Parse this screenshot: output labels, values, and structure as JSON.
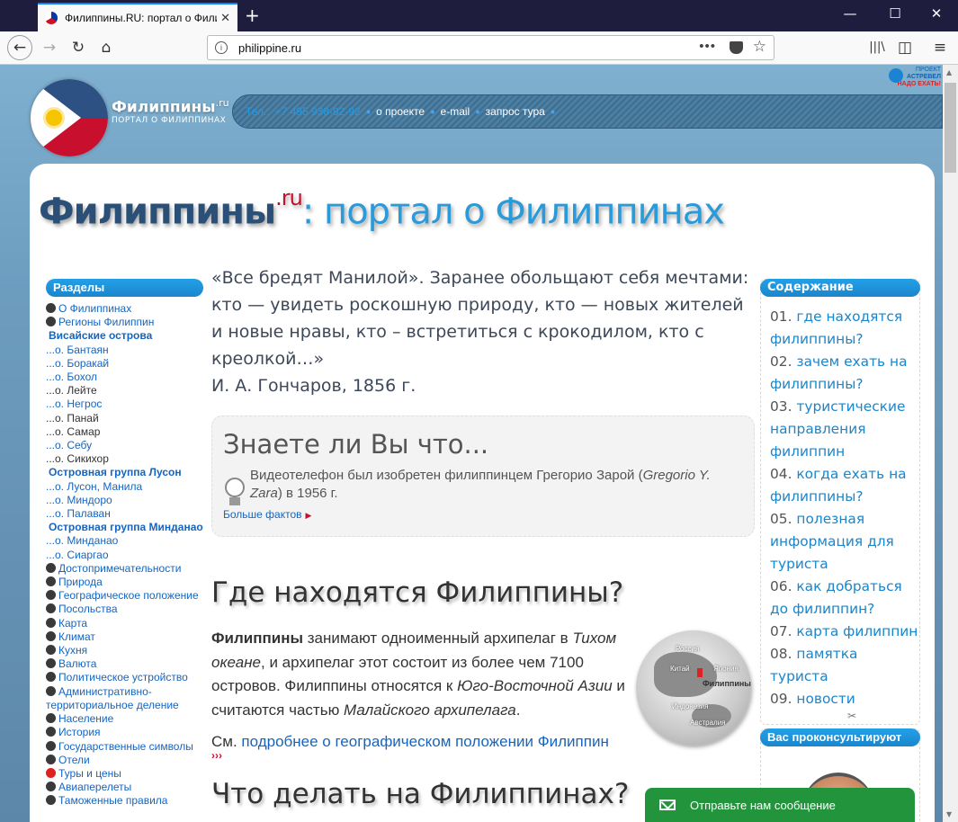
{
  "tab": {
    "title": "Филиппины.RU: портал о Филиппинах",
    "close": "✕",
    "new": "+"
  },
  "window": {
    "minimize": "—",
    "maximize": "☐",
    "close": "✕"
  },
  "nav": {
    "back": "←",
    "forward": "→",
    "reload": "↻",
    "home": "⌂",
    "url": "philippine.ru",
    "more": "•••",
    "star": "☆",
    "library": "|||\\",
    "sidebar": "◫",
    "menu": "≡"
  },
  "header": {
    "brand_name": "Филиппины",
    "brand_sup": ".ru",
    "brand_sub": "ПОРТАЛ О ФИЛИППИНАХ",
    "tel_label": "Тел.:",
    "tel": "+7 495 938-92-92",
    "links": [
      "о проекте",
      "e-mail",
      "запрос тура"
    ],
    "astravel_1": "ПРОЕКТ",
    "astravel_2": "АСТРЕВЕЛ",
    "astravel_3": "НАДО ЕХАТЬ!"
  },
  "title": {
    "main": "Филиппины",
    "sup": ".ru",
    "rest": ": портал о Филиппинах"
  },
  "sections": {
    "header": "Разделы",
    "items": [
      {
        "label": "О Филиппинах",
        "type": "icon"
      },
      {
        "label": "Регионы Филиппин",
        "type": "icon"
      },
      {
        "label": "Висайские острова",
        "type": "group"
      },
      {
        "label": "...о. Бантаян",
        "type": "link"
      },
      {
        "label": "...о. Боракай",
        "type": "link"
      },
      {
        "label": "...о. Бохол",
        "type": "link"
      },
      {
        "label": "...о. Лейте",
        "type": "grey"
      },
      {
        "label": "...о. Негрос",
        "type": "link"
      },
      {
        "label": "...о. Панай",
        "type": "grey"
      },
      {
        "label": "...о. Самар",
        "type": "grey"
      },
      {
        "label": "...о. Себу",
        "type": "link"
      },
      {
        "label": "...о. Сикихор",
        "type": "grey"
      },
      {
        "label": "Островная группа Лусон",
        "type": "group"
      },
      {
        "label": "...о. Лусон, Манила",
        "type": "link"
      },
      {
        "label": "...о. Миндоро",
        "type": "link"
      },
      {
        "label": "...о. Палаван",
        "type": "link"
      },
      {
        "label": "Островная группа Минданао",
        "type": "group"
      },
      {
        "label": "...о. Минданао",
        "type": "link"
      },
      {
        "label": "...о. Сиаргао",
        "type": "link"
      },
      {
        "label": "Достопримечательности",
        "type": "icon"
      },
      {
        "label": "Природа",
        "type": "icon"
      },
      {
        "label": "Географическое положение",
        "type": "icon"
      },
      {
        "label": "Посольства",
        "type": "icon"
      },
      {
        "label": "Карта",
        "type": "icon"
      },
      {
        "label": "Климат",
        "type": "icon"
      },
      {
        "label": "Кухня",
        "type": "icon"
      },
      {
        "label": "Валюта",
        "type": "icon"
      },
      {
        "label": "Политическое устройство",
        "type": "icon"
      },
      {
        "label": "Административно-территориальное деление",
        "type": "icon"
      },
      {
        "label": "Население",
        "type": "icon"
      },
      {
        "label": "История",
        "type": "icon"
      },
      {
        "label": "Государственные символы",
        "type": "icon"
      },
      {
        "label": "Отели",
        "type": "icon"
      },
      {
        "label": "Туры и цены",
        "type": "iconred"
      },
      {
        "label": "Авиаперелеты",
        "type": "icon"
      },
      {
        "label": "Таможенные правила",
        "type": "icon"
      }
    ]
  },
  "quote": {
    "text": "«Все бредят Манилой». Заранее обольщают себя мечтами: кто — увидеть роскошную природу, кто — новых жителей и новые нравы, кто – встретиться с крокодилом, кто с креолкой…»",
    "author": "И. А. Гончаров, 1856 г."
  },
  "fact": {
    "title": "Знаете ли Вы что...",
    "text_1": "Видеотелефон был изобретен филиппинцем Грегорио Зарой (",
    "text_em": "Gregorio Y. Zara",
    "text_2": ") в 1956 г.",
    "more": "Больше фактов"
  },
  "where": {
    "heading": "Где находятся Филиппины?",
    "p_b": "Филиппины",
    "p_1": " занимают одноименный архипелаг в ",
    "p_em1": "Тихом океане",
    "p_2": ", и архипелаг этот состоит из более чем 7100 островов. Филиппины относятся к ",
    "p_em2": "Юго-Восточной Азии",
    "p_3": " и считаются частью ",
    "p_em3": "Малайского архипелага",
    "p_4": ".",
    "see": "См. ",
    "see_link": "подробнее о географическом положении Филиппин",
    "see_arrows": "›››",
    "globe": {
      "russia": "Россия",
      "china": "Китай",
      "japan": "Япония",
      "philippines": "Филиппины",
      "indonesia": "Индонезия",
      "australia": "Австралия"
    }
  },
  "what": {
    "heading": "Что делать на Филиппинах?"
  },
  "toc": {
    "header": "Содержание",
    "items": [
      {
        "num": "01.",
        "label": "где находятся филиппины?"
      },
      {
        "num": "02.",
        "label": "зачем ехать на филиппины?"
      },
      {
        "num": "03.",
        "label": "туристические направления филиппин"
      },
      {
        "num": "04.",
        "label": "когда ехать на филиппины?"
      },
      {
        "num": "05.",
        "label": "полезная информация для туриста"
      },
      {
        "num": "06.",
        "label": "как добраться до филиппин?"
      },
      {
        "num": "07.",
        "label": "карта филиппин"
      },
      {
        "num": "08.",
        "label": "памятка туриста"
      },
      {
        "num": "09.",
        "label": "новости"
      }
    ],
    "scissors": "✂"
  },
  "consult": {
    "header": "Вас проконсультируют"
  },
  "chat": {
    "label": "Отправьте нам сообщение"
  },
  "colors": {
    "accent": "#1a86cc",
    "chat": "#22953c",
    "flag_red": "#c8102e",
    "flag_blue": "#2e5184"
  }
}
